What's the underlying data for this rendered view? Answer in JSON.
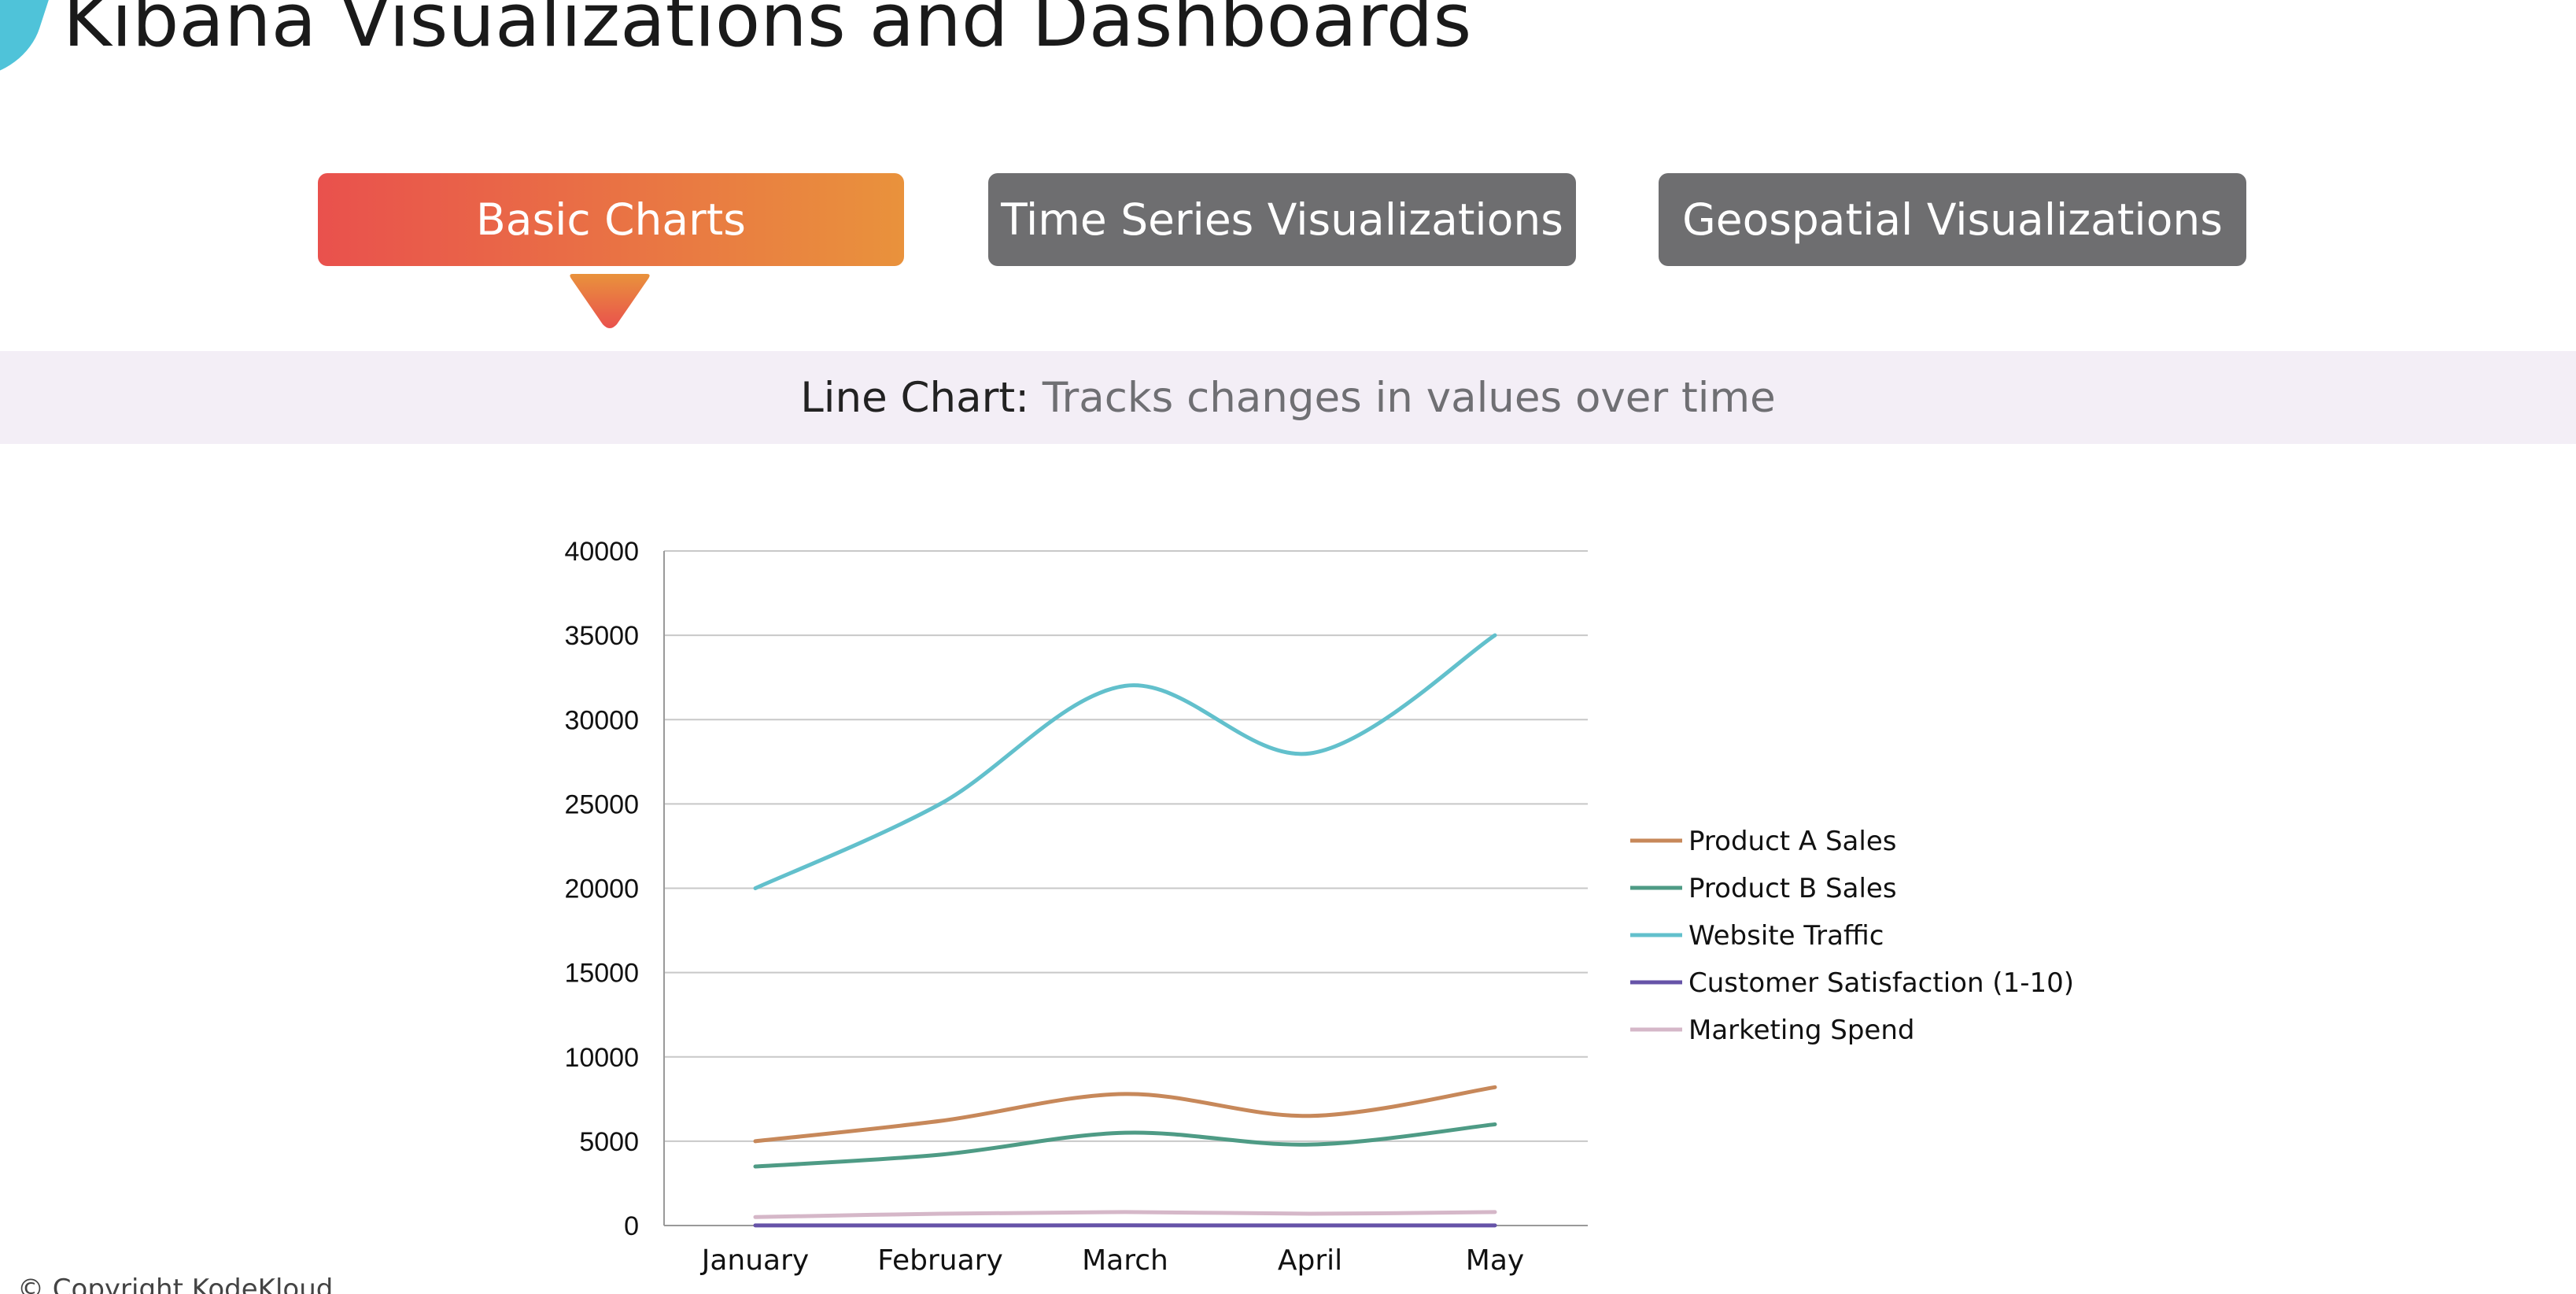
{
  "header": {
    "title": "Kibana Visualizations and Dashboards",
    "logo_icon": "kodekloud-logo-icon",
    "logo_color": "#4fc3d9"
  },
  "tabs": [
    {
      "label": "Basic Charts",
      "active": true
    },
    {
      "label": "Time Series Visualizations",
      "active": false
    },
    {
      "label": "Geospatial Visualizations",
      "active": false
    }
  ],
  "description": {
    "strong": "Line Chart:",
    "soft": "Tracks changes in values over time"
  },
  "colors": {
    "tab_gradient_start": "#e9514d",
    "tab_gradient_end": "#e9923c",
    "tab_inactive": "#6e6e70",
    "band": "#f3eef6"
  },
  "chart_data": {
    "type": "line",
    "categories": [
      "January",
      "February",
      "March",
      "April",
      "May"
    ],
    "ylim": [
      0,
      40000
    ],
    "yticks": [
      0,
      5000,
      10000,
      15000,
      20000,
      25000,
      30000,
      35000,
      40000
    ],
    "grid": true,
    "legend_position": "right",
    "series": [
      {
        "name": "Product A Sales",
        "color": "#c7885a",
        "values": [
          5000,
          6200,
          7800,
          6500,
          8200
        ]
      },
      {
        "name": "Product B Sales",
        "color": "#4e9b85",
        "values": [
          3500,
          4200,
          5500,
          4800,
          6000
        ]
      },
      {
        "name": "Website Traffic",
        "color": "#62c0cc",
        "values": [
          20000,
          25000,
          32000,
          28000,
          35000
        ]
      },
      {
        "name": "Customer Satisfaction (1-10)",
        "color": "#6653a8",
        "values": [
          8,
          7,
          9,
          6,
          8
        ]
      },
      {
        "name": "Marketing Spend",
        "color": "#d5b7c8",
        "values": [
          500,
          700,
          800,
          700,
          800
        ]
      }
    ]
  },
  "footer": {
    "copyright": "© Copyright KodeKloud"
  }
}
